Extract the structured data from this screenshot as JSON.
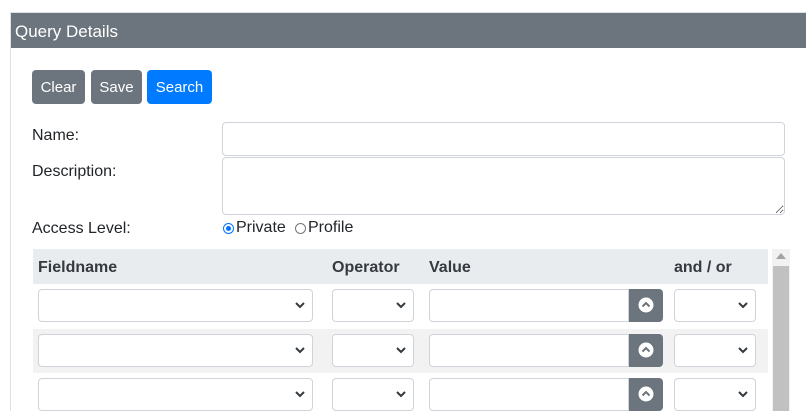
{
  "panel": {
    "title": "Query Details"
  },
  "toolbar": {
    "clear_label": "Clear",
    "save_label": "Save",
    "search_label": "Search"
  },
  "form": {
    "name_label": "Name:",
    "name_value": "",
    "description_label": "Description:",
    "description_value": "",
    "access_label": "Access Level:",
    "access_options": [
      "Private",
      "Profile"
    ],
    "access_selected": "Private"
  },
  "criteria_table": {
    "headers": {
      "fieldname": "Fieldname",
      "operator": "Operator",
      "value": "Value",
      "andor": "and / or"
    },
    "rows": [
      {
        "fieldname": "",
        "operator": "",
        "value": "",
        "andor": ""
      },
      {
        "fieldname": "",
        "operator": "",
        "value": "",
        "andor": ""
      },
      {
        "fieldname": "",
        "operator": "",
        "value": "",
        "andor": ""
      }
    ]
  },
  "colors": {
    "header_bg": "#6c757d",
    "primary": "#007bff",
    "secondary": "#6c757d",
    "table_header_bg": "#e9ecef"
  },
  "icons": {
    "select_arrow": "chevron-down-icon",
    "value_button": "chevron-up-circle-icon"
  }
}
